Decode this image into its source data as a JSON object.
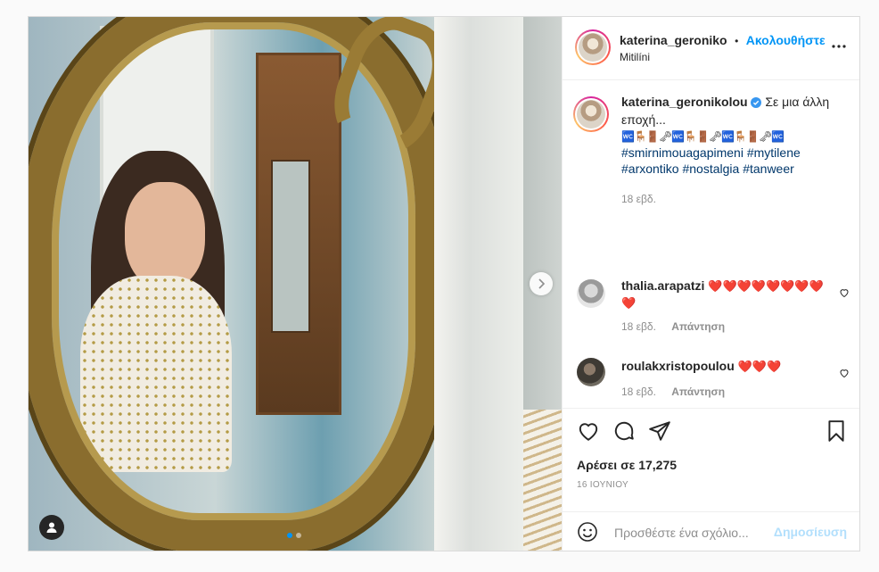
{
  "post": {
    "username": "katerina_geroniko",
    "follow_separator": "•",
    "follow_label": "Ακολουθήστε",
    "location": "Mitilíni",
    "more_label": "•••"
  },
  "caption": {
    "username": "katerina_geronikolou",
    "text": "Σε μια άλλη εποχή...",
    "emoji_line": "🚾🪑🚪🗝🚾🪑🚪🗝🚾🪑🚪🗝🚾",
    "hashtags": [
      "#smirnimouagapimeni",
      "#mytilene",
      "#arxontiko",
      "#nostalgia",
      "#tanweer"
    ],
    "time": "18 εβδ."
  },
  "comments": [
    {
      "username": "thalia.arapatzi",
      "text": "❤️❤️❤️❤️❤️❤️❤️❤️❤️",
      "time": "18 εβδ.",
      "reply": "Απάντηση"
    },
    {
      "username": "roulakxristopoulou",
      "text": "❤️❤️❤️",
      "time": "18 εβδ.",
      "reply": "Απάντηση"
    }
  ],
  "likes_text": "Αρέσει σε 17,275",
  "date_text": "16 ΙΟΥΝΙΟΥ",
  "add_comment": {
    "placeholder": "Προσθέστε ένα σχόλιο...",
    "post_label": "Δημοσίευση"
  },
  "carousel": {
    "count": 2,
    "active": 0
  },
  "colors": {
    "link": "#0095f6",
    "hashtag": "#00376b",
    "heart": "#e0102d",
    "muted": "#8e8e8e",
    "post_disabled": "#b2dffc"
  },
  "icons": [
    "user-tag-icon",
    "chevron-right-icon",
    "more-options-icon",
    "verified-badge-icon",
    "heart-icon",
    "comment-icon",
    "share-icon",
    "bookmark-icon",
    "emoji-icon"
  ]
}
